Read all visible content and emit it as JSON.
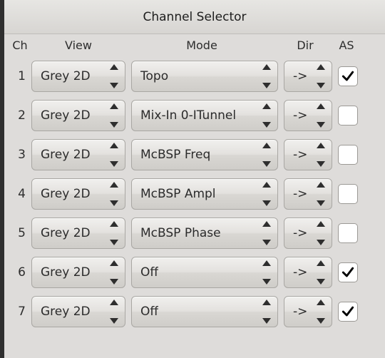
{
  "window": {
    "title": "Channel Selector"
  },
  "headers": {
    "ch": "Ch",
    "view": "View",
    "mode": "Mode",
    "dir": "Dir",
    "as": "AS"
  },
  "rows": [
    {
      "ch": "1",
      "view": "Grey 2D",
      "mode": "Topo",
      "dir": "->",
      "as": true
    },
    {
      "ch": "2",
      "view": "Grey 2D",
      "mode": "Mix-In 0-ITunnel",
      "dir": "->",
      "as": false
    },
    {
      "ch": "3",
      "view": "Grey 2D",
      "mode": "McBSP Freq",
      "dir": "->",
      "as": false
    },
    {
      "ch": "4",
      "view": "Grey 2D",
      "mode": "McBSP Ampl",
      "dir": "->",
      "as": false
    },
    {
      "ch": "5",
      "view": "Grey 2D",
      "mode": "McBSP Phase",
      "dir": "->",
      "as": false
    },
    {
      "ch": "6",
      "view": "Grey 2D",
      "mode": "Off",
      "dir": "->",
      "as": true
    },
    {
      "ch": "7",
      "view": "Grey 2D",
      "mode": "Off",
      "dir": "->",
      "as": true
    }
  ]
}
